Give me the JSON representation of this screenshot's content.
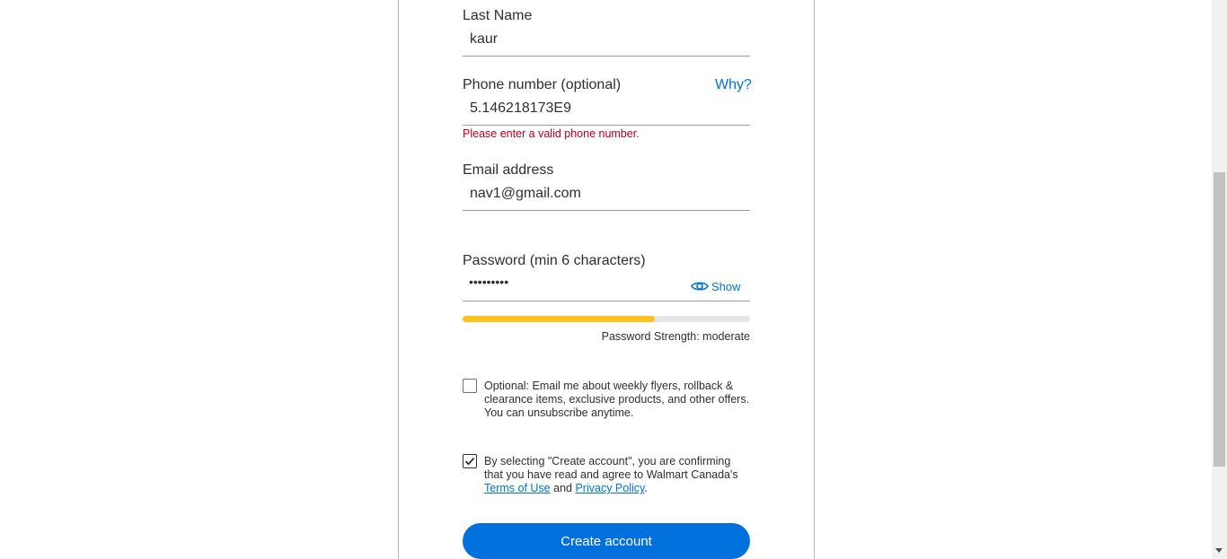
{
  "form": {
    "last_name": {
      "label": "Last Name",
      "value": "kaur"
    },
    "phone": {
      "label": "Phone number (optional)",
      "why_link": "Why?",
      "value": "5.146218173E9",
      "error": "Please enter a valid phone number."
    },
    "email": {
      "label": "Email address",
      "value": "nav1@gmail.com"
    },
    "password": {
      "label": "Password (min 6 characters)",
      "masked_value": "•••••••••",
      "show_label": "Show",
      "strength_label": "Password Strength: moderate",
      "strength_fraction": 0.67,
      "strength_color": "#ffc220"
    },
    "optin": {
      "checked": false,
      "text": "Optional: Email me about weekly flyers, rollback & clearance items, exclusive products, and other offers. You can unsubscribe anytime."
    },
    "terms": {
      "checked": true,
      "text_before": "By selecting \"Create account\", you are confirming that you have read and agree to Walmart Canada's",
      "terms_link": "Terms of Use",
      "and": "and",
      "privacy_link": "Privacy Policy",
      "period": "."
    },
    "submit_label": "Create account"
  },
  "colors": {
    "accent": "#0071dc",
    "error": "#b00020",
    "strength": "#ffc220"
  }
}
